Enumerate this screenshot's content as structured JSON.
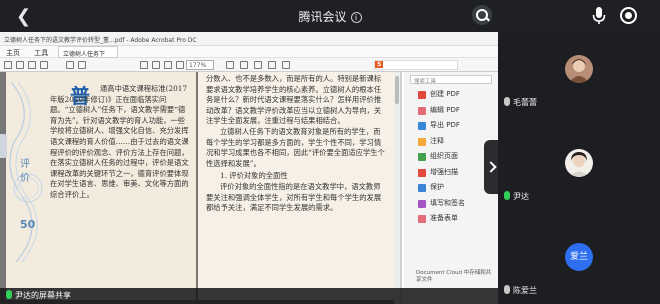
{
  "meeting": {
    "title": "腾讯会议",
    "info_glyph": "i"
  },
  "acrobat": {
    "window_title": "立德树人任务下的语文教学评价转型_董...pdf - Adobe Acrobat Pro DC",
    "menu": [
      "主页",
      "工具"
    ],
    "doc_tab": "立德树人任务下的...",
    "zoom": "177%",
    "input_method": "S"
  },
  "document": {
    "left_page": {
      "big_char": "普",
      "side_words": "评价",
      "page_number": "50",
      "text": "通高中语文课程标准(2017年版2020年修订)》正在面临落实问题。“立德树人”任务下，语文教学需要“德育为先”。针对语文教学的育人功能，一些学校将立德树人、增强文化自信、充分发挥语文课程的育人价值……由于过去的语文课程评价的评价观念、评价方法上存在问题，在落实立德树人任务的过程中，评价是语文课程改革的关键环节之一，德育评价要体现在对学生语言、思维、审美、文化等方面的综合评价上。"
    },
    "right_page": {
      "para1": "分数入、也不是多数入，而是所有的人。特别是新课标要求语文教学培养学生的核心素养。立德树人的根本任务是什么？新时代语文课程要落实什么？怎样用评价推动改革？语文教学评价改革应当以立德树人为导向，关注学生全面发展，注重过程与结果相结合。",
      "para2": "立德树人任务下的语文教育对象是所有的学生，而每个学生的学习都是多方面的，学生个性不同，学习情况和学习成果也各不相同，因此“评价要全面适应学生个性选择和发展”。",
      "subhead": "1. 评价对象的全面性",
      "para3": "评价对象的全面性指的是在语文教学中，语文教师要关注和强调全体学生，对所有学生和每个学生的发展都给予关注，满足不同学生发展的需求。"
    }
  },
  "tools_panel": {
    "search_placeholder": "搜索工具",
    "items": [
      {
        "label": "创建 PDF",
        "color": "#e3483c"
      },
      {
        "label": "编辑 PDF",
        "color": "#e66b7a"
      },
      {
        "label": "导出 PDF",
        "color": "#3a85d6"
      },
      {
        "label": "注释",
        "color": "#f0a93a"
      },
      {
        "label": "组织页面",
        "color": "#47a04c"
      },
      {
        "label": "增强扫描",
        "color": "#e3483c"
      },
      {
        "label": "保护",
        "color": "#3a85d6"
      },
      {
        "label": "填写和签名",
        "color": "#a452c4"
      },
      {
        "label": "准备表单",
        "color": "#e66b7a"
      }
    ],
    "document_cloud": "Document Cloud 中存储和共享文件"
  },
  "presenter": {
    "label": "尹达的屏幕共享"
  },
  "participants": [
    {
      "name": "毛蕾蕾",
      "mic": "off",
      "avatar": "photo"
    },
    {
      "name": "尹达",
      "mic": "on",
      "avatar": "photo"
    },
    {
      "name": "陈爱兰",
      "mic": "off",
      "avatar": "text",
      "avatar_text": "爱兰"
    }
  ]
}
